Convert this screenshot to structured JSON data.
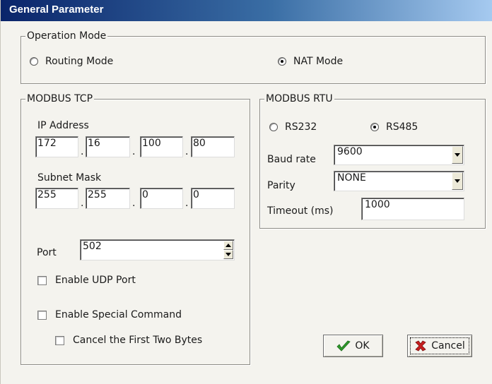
{
  "window": {
    "title": "General Parameter"
  },
  "operation_mode": {
    "legend": "Operation Mode",
    "options": [
      {
        "label": "Routing Mode",
        "selected": false
      },
      {
        "label": "NAT Mode",
        "selected": true
      }
    ]
  },
  "modbus_tcp": {
    "legend": "MODBUS TCP",
    "ip_label": "IP Address",
    "ip": [
      "172",
      "16",
      "100",
      "80"
    ],
    "subnet_label": "Subnet Mask",
    "subnet": [
      "255",
      "255",
      "0",
      "0"
    ],
    "separator": ".",
    "port_label": "Port",
    "port": "502",
    "enable_udp_label": "Enable UDP Port",
    "enable_special_label": "Enable Special Command",
    "cancel_two_bytes_label": "Cancel the First Two Bytes"
  },
  "modbus_rtu": {
    "legend": "MODBUS RTU",
    "options": [
      {
        "label": "RS232",
        "selected": false
      },
      {
        "label": "RS485",
        "selected": true
      }
    ],
    "baud_label": "Baud rate",
    "baud_value": "9600",
    "parity_label": "Parity",
    "parity_value": "NONE",
    "timeout_label": "Timeout (ms)",
    "timeout_value": "1000"
  },
  "buttons": {
    "ok": "OK",
    "cancel": "Cancel"
  },
  "colors": {
    "title_start": "#0a246a",
    "title_end": "#a6caf0",
    "ok_check": "#2e9a2a",
    "cancel_x": "#c81e1e"
  }
}
